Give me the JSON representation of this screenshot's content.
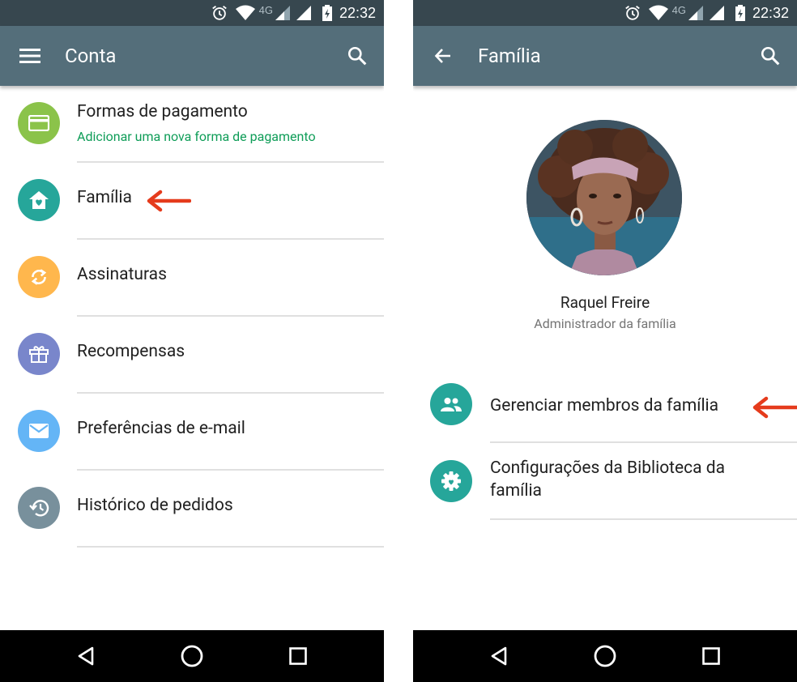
{
  "status_bar": {
    "time": "22:32",
    "network_type": "4G"
  },
  "screens": {
    "left": {
      "title": "Conta",
      "nav_icon": "menu-icon",
      "action_icon": "search-icon",
      "items": [
        {
          "label": "Formas de pagamento",
          "sublabel": "Adicionar uma nova forma de pagamento",
          "icon": "credit-card-icon",
          "color": "#8bc34a"
        },
        {
          "label": "Família",
          "icon": "family-home-icon",
          "color": "#26a69a"
        },
        {
          "label": "Assinaturas",
          "icon": "sync-icon",
          "color": "#ffb74d"
        },
        {
          "label": "Recompensas",
          "icon": "gift-icon",
          "color": "#7986cb"
        },
        {
          "label": "Preferências de e-mail",
          "icon": "mail-icon",
          "color": "#64b5f6"
        },
        {
          "label": "Histórico de pedidos",
          "icon": "history-icon",
          "color": "#78909c"
        }
      ]
    },
    "right": {
      "title": "Família",
      "nav_icon": "back-arrow-icon",
      "action_icon": "search-icon",
      "profile": {
        "name": "Raquel Freire",
        "role": "Administrador da família"
      },
      "items": [
        {
          "label": "Gerenciar membros da família",
          "icon": "group-icon"
        },
        {
          "label": "Configurações da Biblioteca da família",
          "icon": "settings-icon"
        }
      ]
    }
  },
  "colors": {
    "status_bar": "#37474f",
    "toolbar": "#546e7a",
    "accent_green": "#0f9d58",
    "annotation_arrow": "#e53b1c",
    "family_icon": "#26a69a"
  }
}
